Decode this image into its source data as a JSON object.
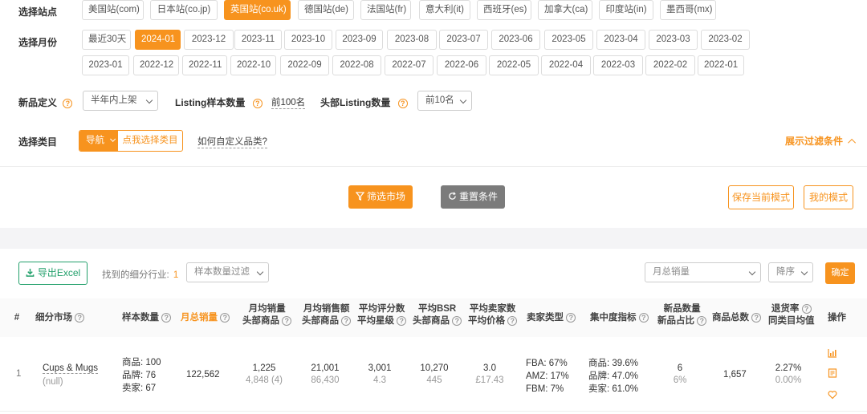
{
  "filters": {
    "site_label": "选择站点",
    "sites": [
      "美国站(com)",
      "日本站(co.jp)",
      "英国站(co.uk)",
      "德国站(de)",
      "法国站(fr)",
      "意大利(it)",
      "西班牙(es)",
      "加拿大(ca)",
      "印度站(in)",
      "墨西哥(mx)"
    ],
    "active_site": "英国站(co.uk)",
    "month_label": "选择月份",
    "months_row1": [
      "最近30天",
      "2024-01",
      "2023-12",
      "2023-11",
      "2023-10",
      "2023-09",
      "2023-08",
      "2023-07",
      "2023-06",
      "2023-05",
      "2023-04",
      "2023-03",
      "2023-02"
    ],
    "months_row2": [
      "2023-01",
      "2022-12",
      "2022-11",
      "2022-10",
      "2022-09",
      "2022-08",
      "2022-07",
      "2022-06",
      "2022-05",
      "2022-04",
      "2022-03",
      "2022-02",
      "2022-01"
    ],
    "active_month": "2024-01",
    "new_def_label": "新品定义",
    "new_def_value": "半年内上架",
    "listing_sample_label": "Listing样本数量",
    "listing_sample_value": "前100名",
    "top_listing_label": "头部Listing数量",
    "top_listing_value": "前10名",
    "category_label": "选择类目",
    "nav_btn": "导航",
    "pick_category": "点我选择类目",
    "custom_category_link": "如何自定义品类?",
    "show_filters": "展示过滤条件",
    "help_glyph": "?"
  },
  "actions": {
    "filter_market": "筛选市场",
    "reset": "重置条件",
    "save_mode": "保存当前模式",
    "my_mode": "我的模式"
  },
  "toolbar": {
    "export": "导出Excel",
    "found_label": "找到的细分行业:",
    "found_count": "1",
    "sample_filter": "样本数量过滤",
    "sort_field": "月总销量",
    "sort_order": "降序",
    "confirm": "确定"
  },
  "table": {
    "headers": {
      "index": "#",
      "market": "细分市场",
      "sample": "样本数量",
      "monthly_sales": "月总销量",
      "avg_sales_1": "月均销量",
      "avg_sales_2": "头部商品",
      "avg_revenue_1": "月均销售额",
      "avg_revenue_2": "头部商品",
      "rating_1": "平均评分数",
      "rating_2": "平均星级",
      "bsr_1": "平均BSR",
      "bsr_2": "头部商品",
      "sellers_1": "平均卖家数",
      "sellers_2": "平均价格",
      "seller_type": "卖家类型",
      "concentration": "集中度指标",
      "new_1": "新品数量",
      "new_2": "新品占比",
      "total_products": "商品总数",
      "return_1": "退货率",
      "return_2": "同类目均值",
      "ops": "操作"
    },
    "rows": [
      {
        "index": "1",
        "market": "Cups & Mugs",
        "market_sub": "(null)",
        "sample_products": "商品: 100",
        "sample_brands": "品牌: 76",
        "sample_sellers": "卖家: 67",
        "monthly_sales": "122,562",
        "avg_sales": "1,225",
        "avg_sales_top": "4,848 (4)",
        "avg_revenue": "21,001",
        "avg_revenue_top": "86,430",
        "rating_count": "3,001",
        "rating_star": "4.3",
        "bsr": "10,270",
        "bsr_top": "445",
        "sellers": "3.0",
        "price": "£17.43",
        "fba": "FBA: 67%",
        "amz": "AMZ: 17%",
        "fbm": "FBM: 7%",
        "conc_products": "商品: 39.6%",
        "conc_brands": "品牌: 47.0%",
        "conc_sellers": "卖家: 61.0%",
        "new_count": "6",
        "new_ratio": "6%",
        "total_products": "1,657",
        "return_rate": "2.27%",
        "return_avg": "0.00%"
      }
    ]
  },
  "colors": {
    "accent": "#f7931e",
    "green": "#22a06b",
    "gray_btn": "#7b7b7b"
  }
}
